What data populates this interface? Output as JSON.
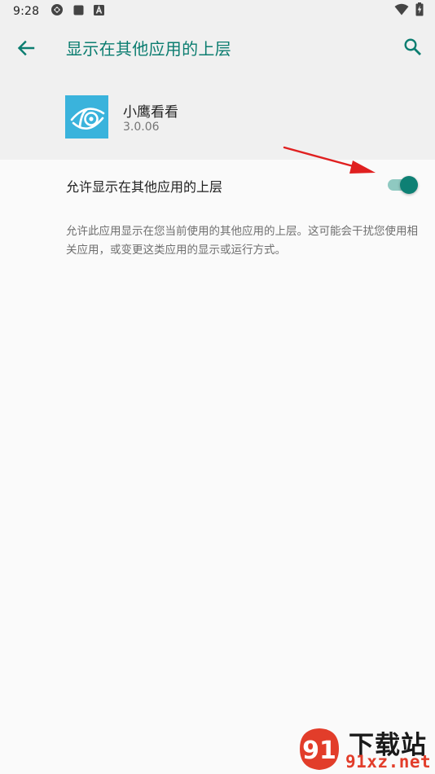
{
  "status_bar": {
    "time": "9:28",
    "icons": [
      "location-icon",
      "square-icon",
      "a-badge-icon"
    ],
    "right_icons": [
      "wifi-icon",
      "battery-icon"
    ]
  },
  "app_bar": {
    "title": "显示在其他应用的上层",
    "back_icon": "back-arrow-icon",
    "search_icon": "search-icon"
  },
  "app": {
    "name": "小鹰看看",
    "version": "3.0.06"
  },
  "setting": {
    "label": "允许显示在其他应用的上层",
    "enabled": true,
    "description": "允许此应用显示在您当前使用的其他应用的上层。这可能会干扰您使用相关应用，或变更这类应用的显示或运行方式。"
  },
  "colors": {
    "accent": "#0b7d70",
    "switch_thumb": "#0e8074",
    "switch_track": "#8fc9c1",
    "app_icon_bg": "#3ab3dc",
    "annotation": "#e02020"
  },
  "watermark": {
    "text_main": "下载站",
    "text_domain": "91xz.net",
    "logo_text": "91"
  }
}
